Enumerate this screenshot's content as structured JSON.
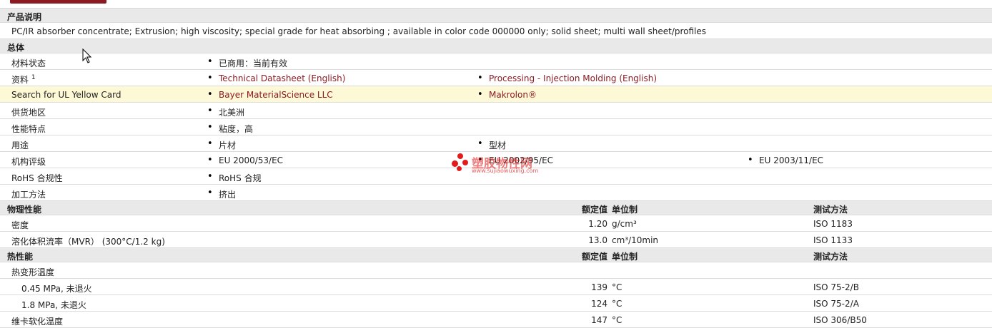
{
  "sections": {
    "desc_title": "产品说明",
    "desc_text": "PC/IR absorber concentrate; Extrusion; high viscosity; special grade for heat absorbing ; available in color code 000000 only; solid sheet; multi wall sheet/profiles",
    "general_title": "总体",
    "physical_title": "物理性能",
    "thermal_title": "热性能"
  },
  "headers": {
    "nominal": "额定值",
    "unit": "单位制",
    "test": "测试方法"
  },
  "general": {
    "status_label": "材料状态",
    "status_value": "已商用：当前有效",
    "docs_label": "资料",
    "docs_sup": "1",
    "doc1": "Technical Datasheet (English)",
    "doc2": "Processing - Injection Molding (English)",
    "ul_label": "Search for UL Yellow Card",
    "ul1": "Bayer MaterialScience LLC",
    "ul2": "Makrolon®",
    "region_label": "供货地区",
    "region_value": "北美洲",
    "feature_label": "性能特点",
    "feature_value": "粘度，高",
    "use_label": "用途",
    "use1": "片材",
    "use2": "型材",
    "agency_label": "机构评级",
    "agency1": "EU 2000/53/EC",
    "agency2": "EU 2002/95/EC",
    "agency3": "EU 2003/11/EC",
    "rohs_label": "RoHS 合规性",
    "rohs_value": "RoHS 合规",
    "process_label": "加工方法",
    "process_value": "挤出"
  },
  "physical": [
    {
      "label": "密度",
      "value": "1.20",
      "unit": "g/cm³",
      "test": "ISO 1183"
    },
    {
      "label": "溶化体积流率（MVR） (300°C/1.2 kg)",
      "value": "13.0",
      "unit": "cm³/10min",
      "test": "ISO 1133"
    }
  ],
  "thermal": {
    "hdt_label": "热变形温度",
    "rows": [
      {
        "label": "0.45 MPa, 未退火",
        "value": "139",
        "unit": "°C",
        "test": "ISO 75-2/B"
      },
      {
        "label": "1.8 MPa, 未退火",
        "value": "124",
        "unit": "°C",
        "test": "ISO 75-2/A"
      },
      {
        "label": "维卡软化温度",
        "value": "147",
        "unit": "°C",
        "test": "ISO 306/B50"
      }
    ]
  },
  "watermark": {
    "title": "塑胶物性网",
    "url": "www.sujiaowuxing.com"
  }
}
